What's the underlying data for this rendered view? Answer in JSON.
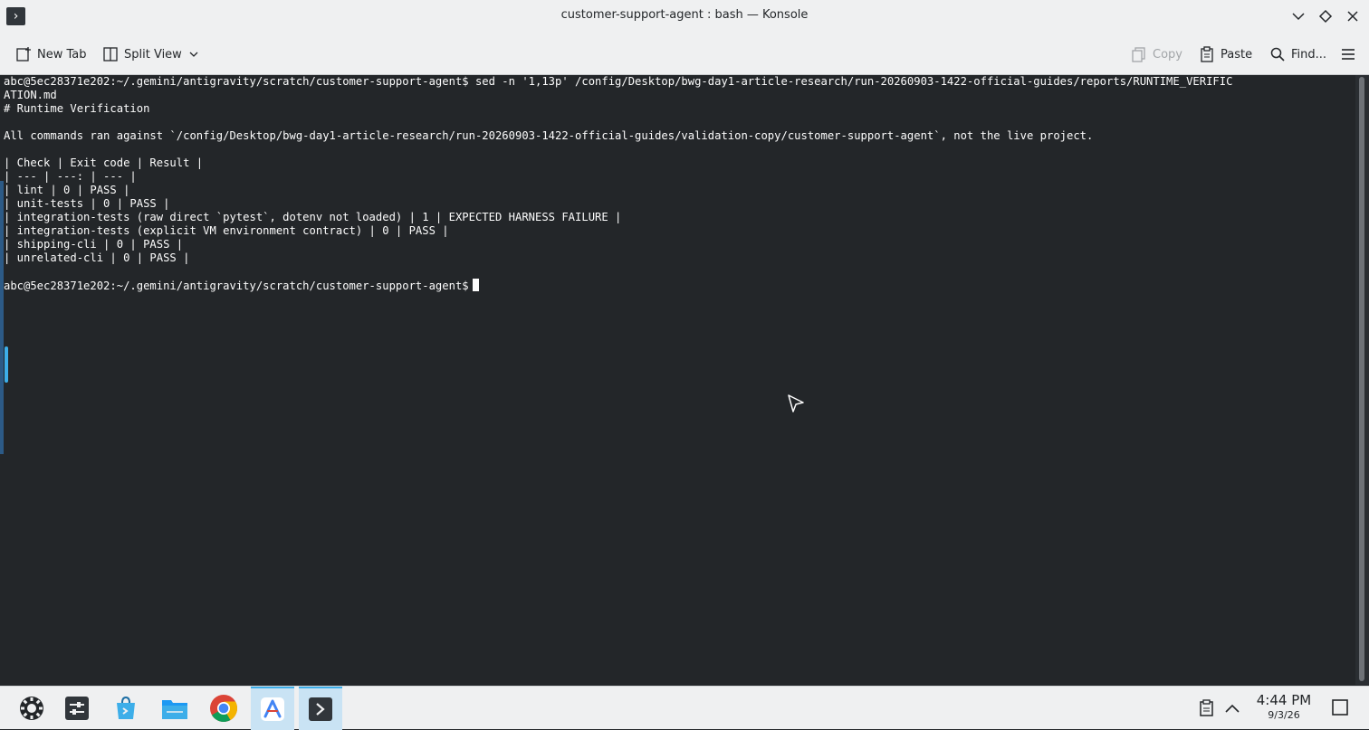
{
  "window": {
    "title": "customer-support-agent : bash — Konsole"
  },
  "toolbar": {
    "new_tab": "New Tab",
    "split_view": "Split View",
    "copy": "Copy",
    "paste": "Paste",
    "find": "Find..."
  },
  "terminal": {
    "lines": [
      "abc@5ec28371e202:~/.gemini/antigravity/scratch/customer-support-agent$ sed -n '1,13p' /config/Desktop/bwg-day1-article-research/run-20260903-1422-official-guides/reports/RUNTIME_VERIFIC",
      "ATION.md",
      "# Runtime Verification",
      "",
      "All commands ran against `/config/Desktop/bwg-day1-article-research/run-20260903-1422-official-guides/validation-copy/customer-support-agent`, not the live project.",
      "",
      "| Check | Exit code | Result |",
      "| --- | ---: | --- |",
      "| lint | 0 | PASS |",
      "| unit-tests | 0 | PASS |",
      "| integration-tests (raw direct `pytest`, dotenv not loaded) | 1 | EXPECTED HARNESS FAILURE |",
      "| integration-tests (explicit VM environment contract) | 0 | PASS |",
      "| shipping-cli | 0 | PASS |",
      "| unrelated-cli | 0 | PASS |",
      ""
    ],
    "prompt": "abc@5ec28371e202:~/.gemini/antigravity/scratch/customer-support-agent$"
  },
  "taskbar": {
    "items": [
      "app-launcher-icon",
      "system-settings-icon",
      "discover-icon",
      "file-manager-icon",
      "chrome-icon",
      "antigravity-icon",
      "konsole-icon"
    ],
    "time": "4:44 PM",
    "date": "9/3/26"
  },
  "colors": {
    "terminal_bg": "#232629",
    "terminal_fg": "#fcfcfc",
    "accent": "#3daee9",
    "chrome_bg": "#eff0f1"
  }
}
